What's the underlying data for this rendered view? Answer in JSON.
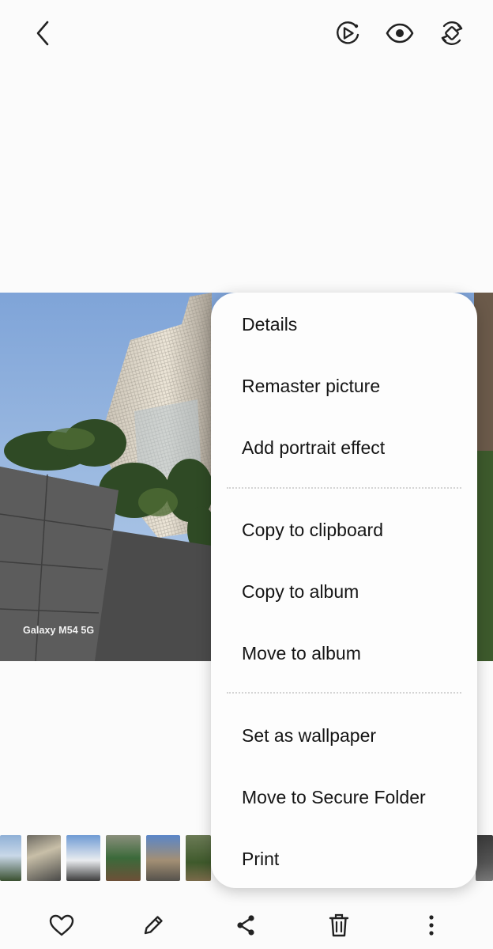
{
  "header": {
    "icons": [
      "back-arrow-icon",
      "motion-play-icon",
      "eye-icon",
      "rotate-icon"
    ]
  },
  "photo": {
    "watermark": "Galaxy M54 5G"
  },
  "menu": {
    "items": [
      "Details",
      "Remaster picture",
      "Add portrait effect",
      "Copy to clipboard",
      "Copy to album",
      "Move to album",
      "Set as wallpaper",
      "Move to Secure Folder",
      "Print"
    ]
  },
  "bottom_bar": {
    "icons": [
      "heart-icon",
      "pencil-icon",
      "share-icon",
      "trash-icon",
      "more-vertical-icon"
    ]
  },
  "colors": {
    "background": "#fbfbfb",
    "menu_background": "#fdfdfd",
    "icon": "#222222",
    "divider": "#d4d4d4"
  }
}
